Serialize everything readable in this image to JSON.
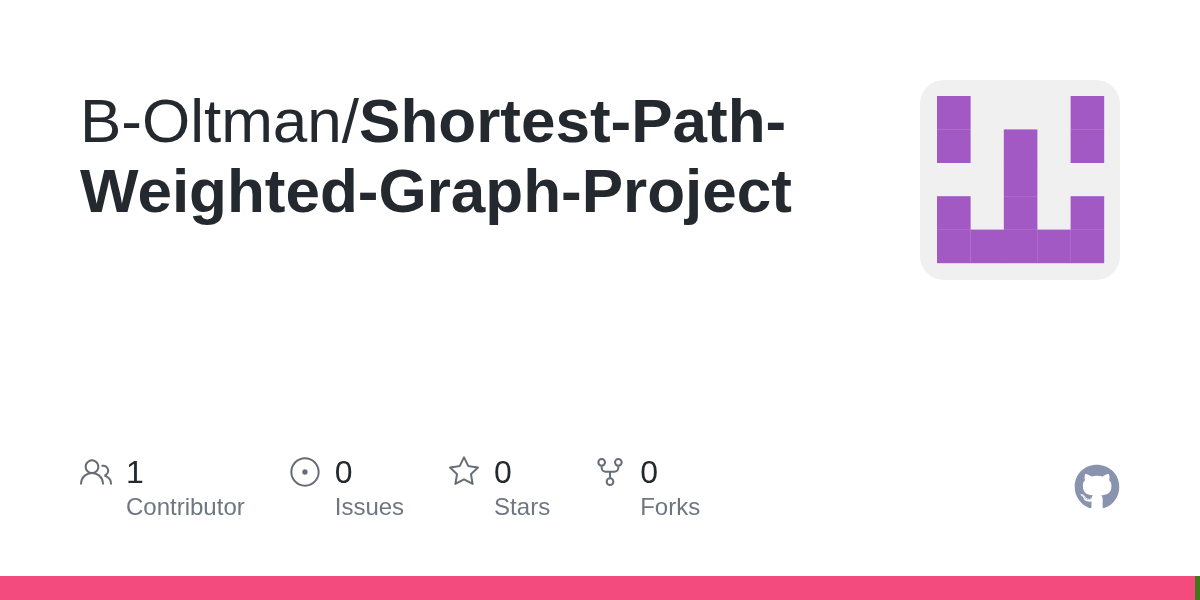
{
  "repo_title": "B-Oltman/**Shortest-Path-Weighted-Graph-Project**",
  "stats": [
    {
      "kind": "contributors",
      "count": "1",
      "label": "Contributor"
    },
    {
      "kind": "issues",
      "count": "0",
      "label": "Issues"
    },
    {
      "kind": "stars",
      "count": "0",
      "label": "Stars"
    },
    {
      "kind": "forks",
      "count": "0",
      "label": "Forks"
    }
  ],
  "languages": [
    {
      "color": "#f34b7d",
      "level": 0.996
    },
    {
      "color": "#427819",
      "level": 0.004
    }
  ]
}
